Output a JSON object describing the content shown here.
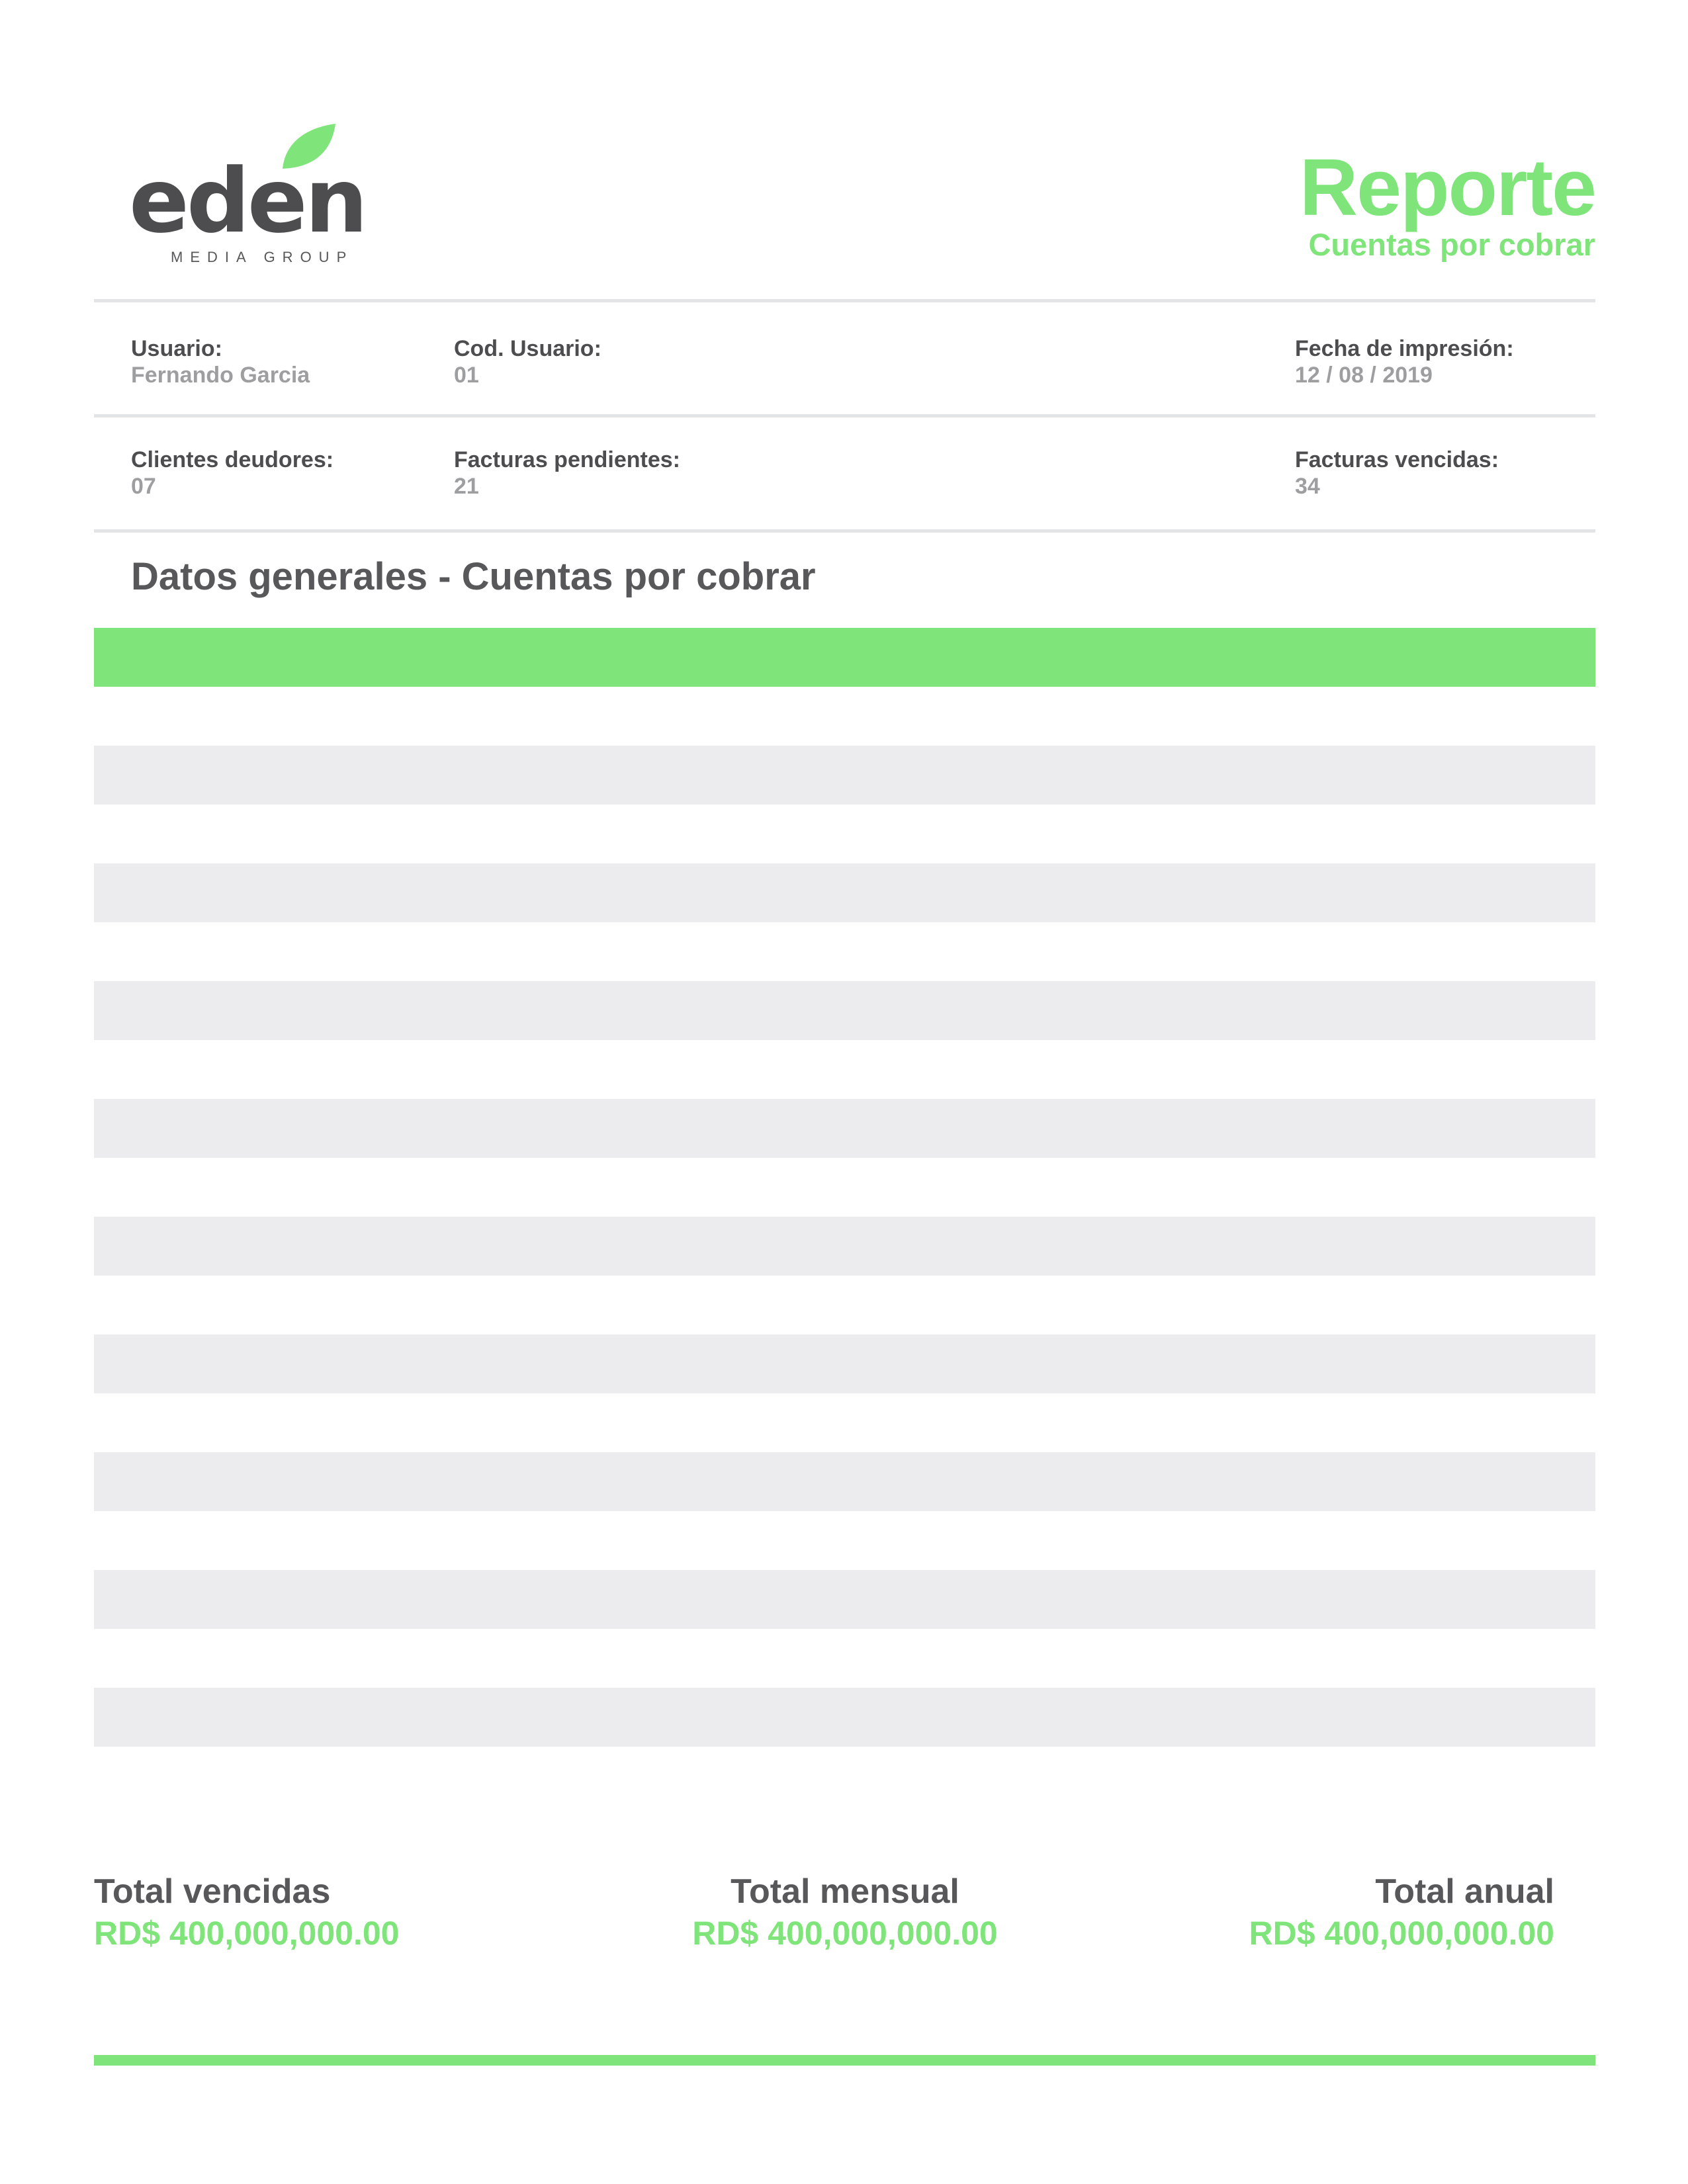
{
  "logo": {
    "wordmark": "eden",
    "tagline": "MEDIA GROUP",
    "leaf_color": "#7fe57a"
  },
  "report": {
    "title": "Reporte",
    "subtitle": "Cuentas por cobrar"
  },
  "info": {
    "usuario_label": "Usuario:",
    "usuario_value": "Fernando Garcia",
    "cod_label": "Cod. Usuario:",
    "cod_value": "01",
    "fecha_label": "Fecha de impresión:",
    "fecha_value": "12 / 08 / 2019",
    "clientes_label": "Clientes deudores:",
    "clientes_value": "07",
    "pendientes_label": "Facturas pendientes:",
    "pendientes_value": "21",
    "vencidas_label": "Facturas vencidas:",
    "vencidas_value": "34"
  },
  "section_title": "Datos generales - Cuentas por cobrar",
  "table": {
    "header_color": "#7fe57a",
    "stripe_color": "#ececee",
    "row_count": 18
  },
  "totals": {
    "vencidas_label": "Total vencidas",
    "vencidas_value": "RD$ 400,000,000.00",
    "mensual_label": "Total mensual",
    "mensual_value": "RD$ 400,000,000.00",
    "anual_label": "Total anual",
    "anual_value": "RD$ 400,000,000.00"
  },
  "colors": {
    "accent": "#7fe57a",
    "text_dark": "#58585a",
    "text_muted": "#9d9ea0",
    "rule": "#e3e4e6"
  }
}
